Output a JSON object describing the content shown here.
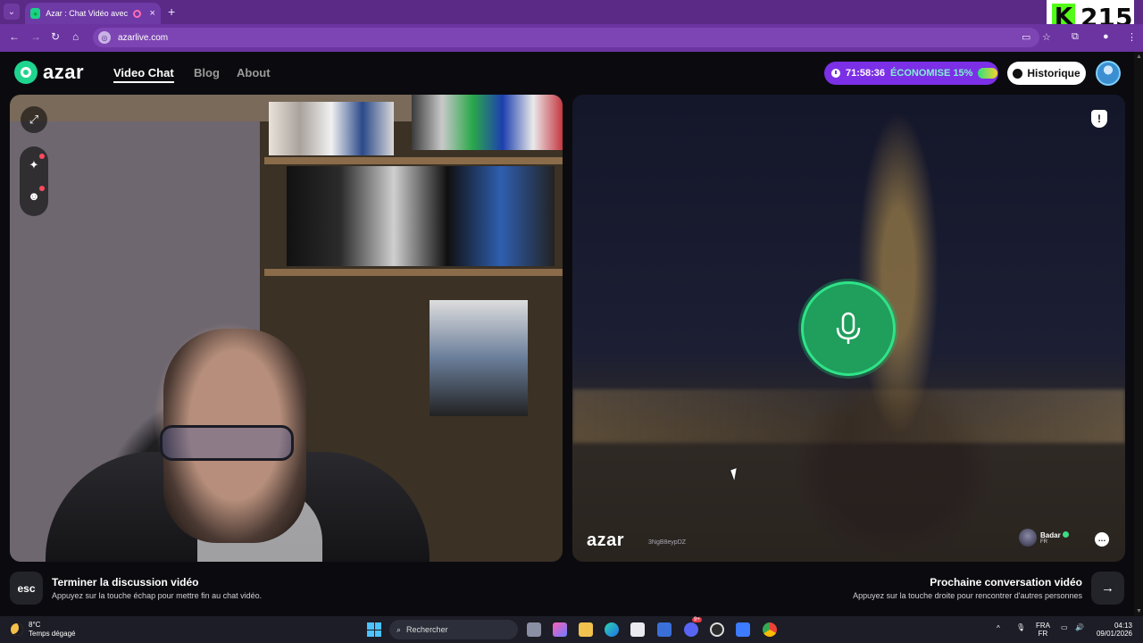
{
  "browser": {
    "tab_title": "Azar : Chat Vidéo avec de n",
    "tab_close": "×",
    "new_tab": "+",
    "url": "azarlive.com"
  },
  "overlay": {
    "k_letter": "K",
    "count": "215"
  },
  "site": {
    "logo_text": "azar",
    "nav": {
      "video_chat": "Video Chat",
      "blog": "Blog",
      "about": "About"
    },
    "timer": "71:58:36",
    "save_text": "ÉCONOMISE 15%",
    "history_label": "Historique"
  },
  "partner_video": {
    "watermark": "azar",
    "watermark_id": "3NgB8eypDZ",
    "partner_name": "Badar",
    "partner_country": "FR"
  },
  "bottom": {
    "esc_key": "esc",
    "end_title": "Terminer la discussion vidéo",
    "end_sub": "Appuyez sur la touche échap pour mettre fin au chat vidéo.",
    "next_title": "Prochaine conversation vidéo",
    "next_sub": "Appuyez sur la touche droite pour rencontrer d'autres personnes",
    "next_key": "→"
  },
  "taskbar": {
    "temp": "8°C",
    "weather": "Temps dégagé",
    "search": "Rechercher",
    "lang_top": "FRA",
    "lang_bottom": "FR",
    "time": "04:13",
    "date": "09/01/2026",
    "badge": "9+"
  },
  "colors": {
    "browser_purple": "#5a2a86",
    "azar_green": "#1fd48e",
    "timer_purple": "#7b2fe6",
    "mic_green": "#1f9e5c"
  }
}
